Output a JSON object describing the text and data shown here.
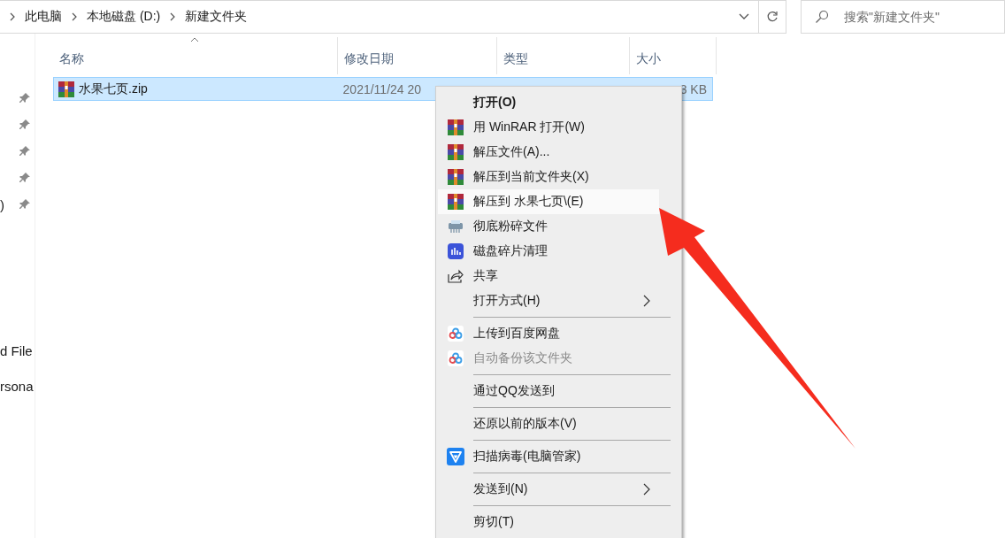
{
  "address_bar": {
    "breadcrumbs": [
      "此电脑",
      "本地磁盘 (D:)",
      "新建文件夹"
    ]
  },
  "search": {
    "placeholder": "搜索\"新建文件夹\""
  },
  "nav_pane": {
    "items": [
      {
        "pinned": true
      },
      {
        "pinned": true
      },
      {
        "pinned": true
      },
      {
        "pinned": true
      },
      {
        "label": ")",
        "pinned": true
      },
      {
        "label": "d File",
        "pinned": false
      },
      {
        "label": "rsona",
        "pinned": false
      }
    ]
  },
  "file_list": {
    "columns": [
      "名称",
      "修改日期",
      "类型",
      "大小"
    ],
    "rows": [
      {
        "name": "水果七页.zip",
        "modified": "2021/11/24 20",
        "size": "3 KB",
        "selected": true
      }
    ]
  },
  "context_menu": {
    "items": [
      {
        "kind": "item",
        "label": "打开(O)",
        "default": true,
        "selected": false,
        "disabled": false,
        "submenu": false
      },
      {
        "kind": "item",
        "label": "用 WinRAR 打开(W)",
        "default": false,
        "selected": false,
        "disabled": false,
        "submenu": false
      },
      {
        "kind": "item",
        "label": "解压文件(A)...",
        "default": false,
        "selected": false,
        "disabled": false,
        "submenu": false
      },
      {
        "kind": "item",
        "label": "解压到当前文件夹(X)",
        "default": false,
        "selected": false,
        "disabled": false,
        "submenu": false
      },
      {
        "kind": "item",
        "label": "解压到 水果七页\\(E)",
        "default": false,
        "selected": true,
        "disabled": false,
        "submenu": false
      },
      {
        "kind": "item",
        "label": "彻底粉碎文件",
        "default": false,
        "selected": false,
        "disabled": false,
        "submenu": false
      },
      {
        "kind": "item",
        "label": "磁盘碎片清理",
        "default": false,
        "selected": false,
        "disabled": false,
        "submenu": false
      },
      {
        "kind": "item",
        "label": "共享",
        "default": false,
        "selected": false,
        "disabled": false,
        "submenu": false
      },
      {
        "kind": "item",
        "label": "打开方式(H)",
        "default": false,
        "selected": false,
        "disabled": false,
        "submenu": true
      },
      {
        "kind": "separator"
      },
      {
        "kind": "item",
        "label": "上传到百度网盘",
        "default": false,
        "selected": false,
        "disabled": false,
        "submenu": false
      },
      {
        "kind": "item",
        "label": "自动备份该文件夹",
        "default": false,
        "selected": false,
        "disabled": true,
        "submenu": false
      },
      {
        "kind": "separator"
      },
      {
        "kind": "item",
        "label": "通过QQ发送到",
        "default": false,
        "selected": false,
        "disabled": false,
        "submenu": false
      },
      {
        "kind": "separator"
      },
      {
        "kind": "item",
        "label": "还原以前的版本(V)",
        "default": false,
        "selected": false,
        "disabled": false,
        "submenu": false
      },
      {
        "kind": "separator"
      },
      {
        "kind": "item",
        "label": "扫描病毒(电脑管家)",
        "default": false,
        "selected": false,
        "disabled": false,
        "submenu": false
      },
      {
        "kind": "separator"
      },
      {
        "kind": "item",
        "label": "发送到(N)",
        "default": false,
        "selected": false,
        "disabled": false,
        "submenu": true
      },
      {
        "kind": "separator"
      },
      {
        "kind": "item",
        "label": "剪切(T)",
        "default": false,
        "selected": false,
        "disabled": false,
        "submenu": false
      }
    ]
  }
}
